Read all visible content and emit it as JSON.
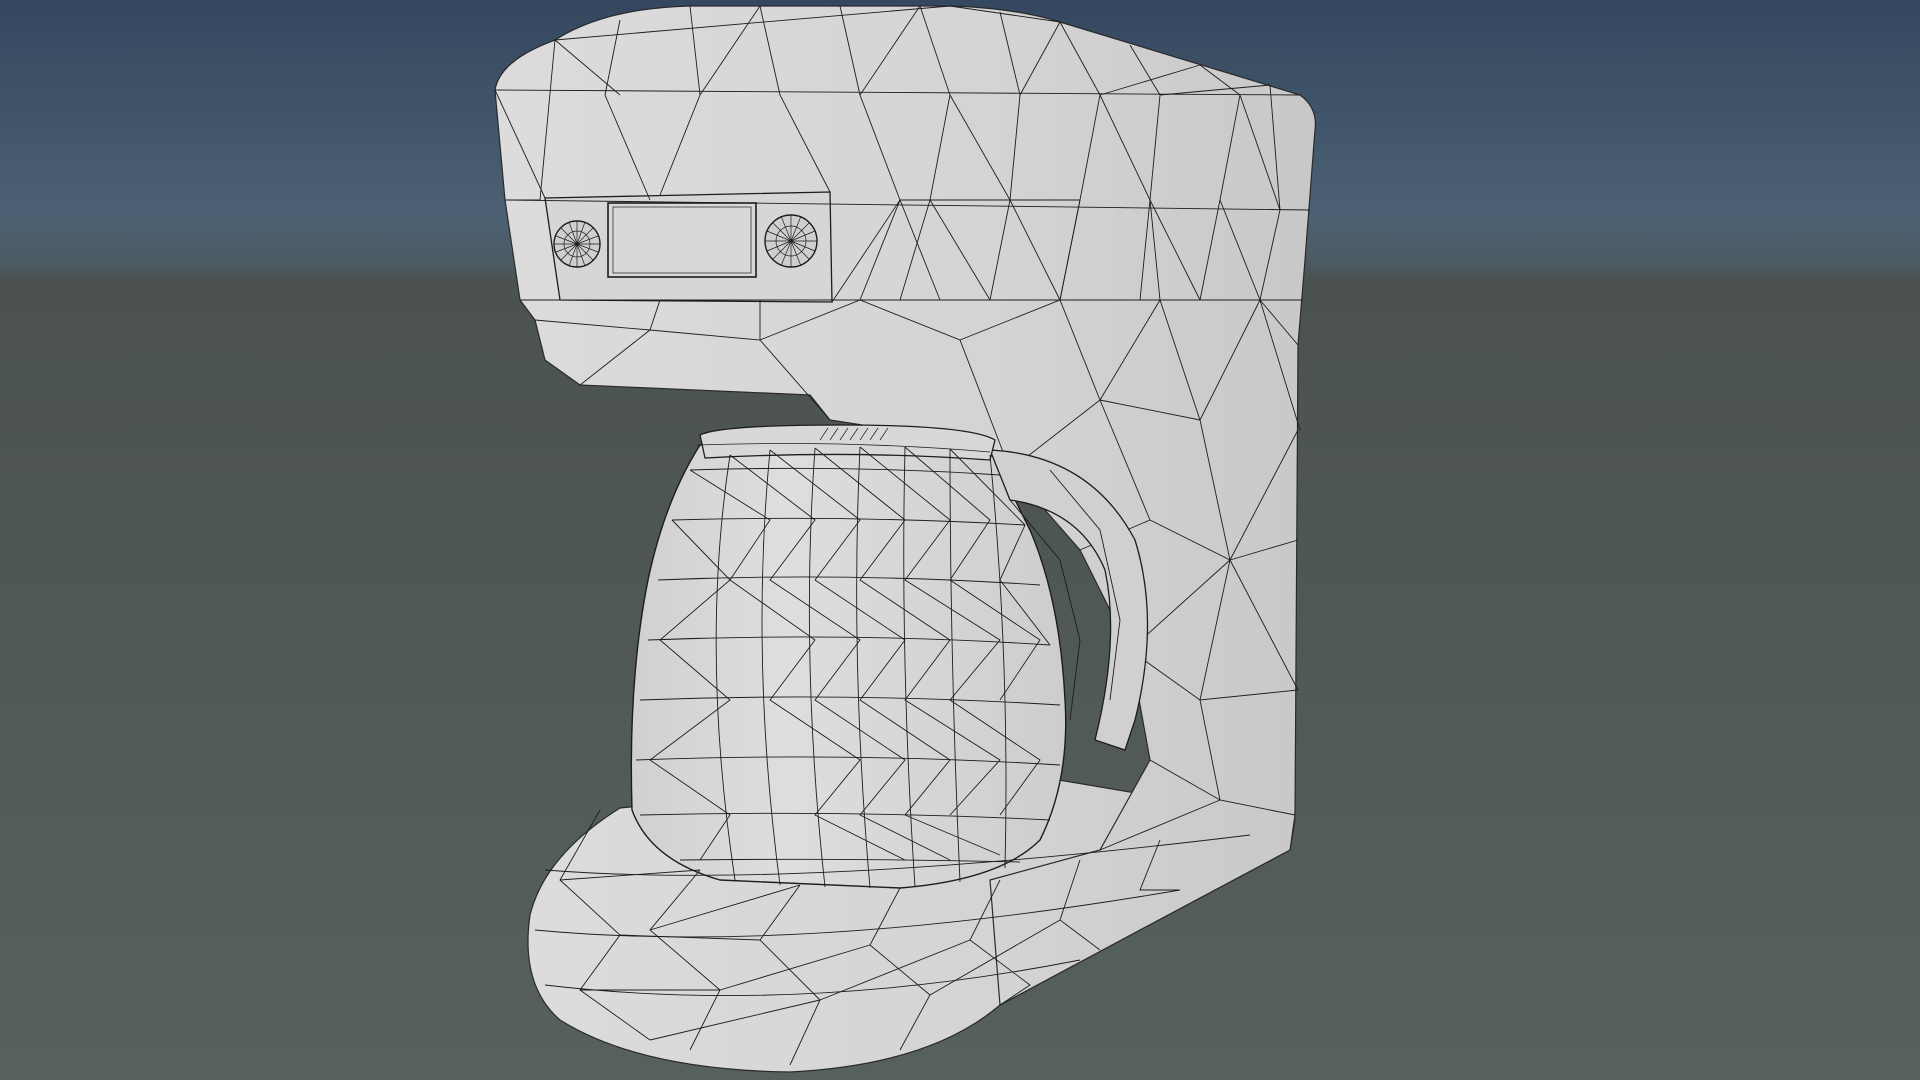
{
  "viewport": {
    "kind": "3d-viewport",
    "view_mode": "wireframe-on-shaded",
    "background": {
      "sky_top": "#34475f",
      "sky_horizon": "#4c6173",
      "ground_top": "#4b524f",
      "ground_bottom": "#56605e"
    }
  },
  "model": {
    "object": "coffee-maker",
    "surface_color": "#d3d3d3",
    "wire_color": "#1d1d1d",
    "parts": [
      "machine-body",
      "control-panel",
      "left-dial",
      "display-screen",
      "right-dial",
      "carafe",
      "carafe-lid",
      "carafe-handle",
      "base-plate"
    ]
  }
}
